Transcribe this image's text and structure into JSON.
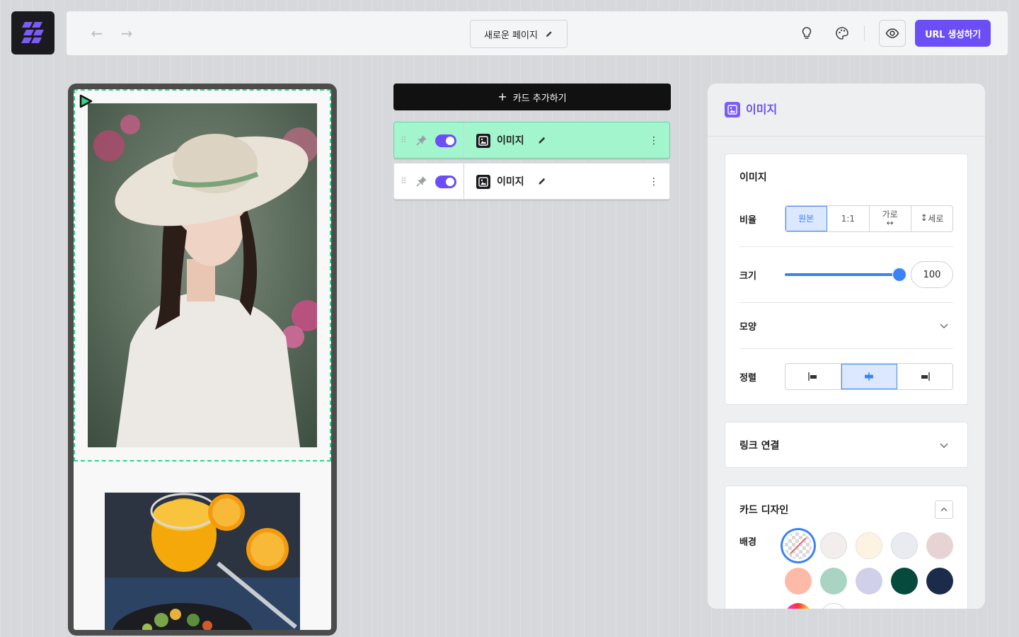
{
  "topbar": {
    "page_title": "새로운 페이지",
    "url_button": "URL 생성하기"
  },
  "card_list": {
    "add_card_label": "카드 추가하기",
    "items": [
      {
        "label": "이미지",
        "enabled": true,
        "active": true
      },
      {
        "label": "이미지",
        "enabled": true,
        "active": false
      }
    ]
  },
  "panel": {
    "title": "이미지",
    "image_section": {
      "title": "이미지",
      "ratio_label": "비율",
      "ratio_options": [
        "원본",
        "1:1",
        "가로",
        "세로"
      ],
      "ratio_selected": "원본",
      "size_label": "크기",
      "size_value": "100",
      "size_fraction": 1.0,
      "shape_label": "모양",
      "align_label": "정렬",
      "align_options": [
        "left",
        "center",
        "right"
      ],
      "align_selected": "center"
    },
    "link_section": {
      "title": "링크 연결"
    },
    "design_section": {
      "title": "카드 디자인",
      "background_label": "배경",
      "colors": [
        "transparent",
        "#f2eeee",
        "#fdf3e2",
        "#e9ebf1",
        "#e7d3d3",
        "#fdbba7",
        "#a9d4c4",
        "#d0d0eb",
        "#064a3e",
        "#1b2c4b"
      ]
    }
  },
  "colors": {
    "accent": "#6b4ef6",
    "active_card": "#a3f5cd",
    "selection_blue": "#3b82f6"
  }
}
